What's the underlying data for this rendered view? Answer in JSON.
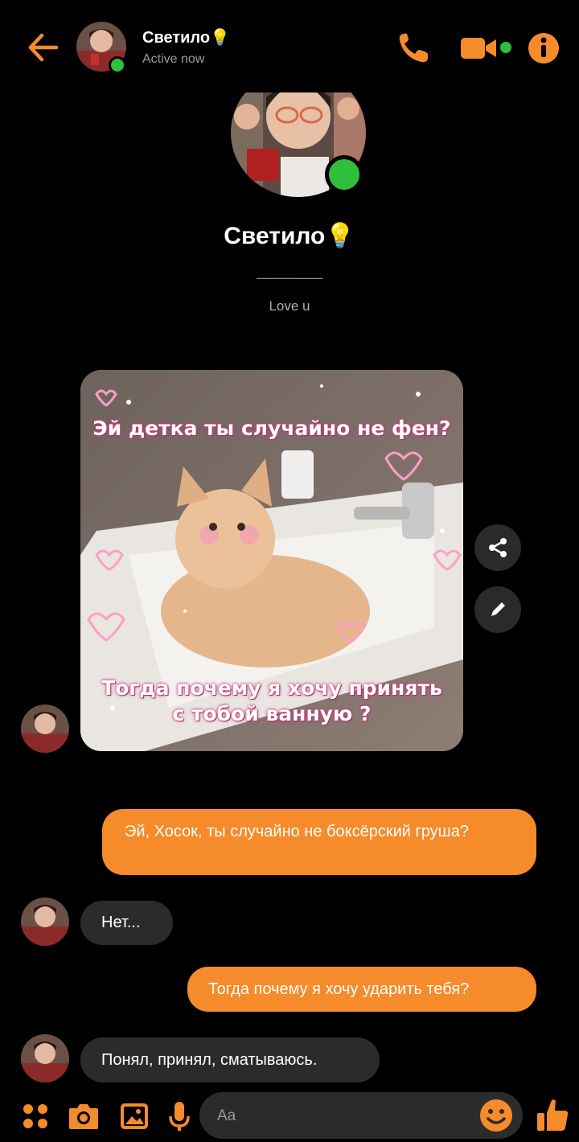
{
  "header": {
    "contact_name": "Светило💡",
    "status": "Active now"
  },
  "profile": {
    "name": "Светило💡",
    "divider": "________",
    "bio": "Love u"
  },
  "image_message": {
    "top_text": "Эй детка ты случайно не фен?",
    "bottom_text": "Тогда почему я хочу принять с тобой ванную ?"
  },
  "messages": [
    {
      "from": "me",
      "text": "Эй, Хосок, ты случайно не боксёрский груша?"
    },
    {
      "from": "them",
      "text": "Нет..."
    },
    {
      "from": "me",
      "text": "Тогда почему я хочу ударить тебя?"
    },
    {
      "from": "them",
      "text": "Понял, принял, сматываюсь."
    }
  ],
  "composer": {
    "placeholder": "Aa"
  },
  "colors": {
    "accent": "#f58b2a",
    "online": "#2fbf3c",
    "incoming_bubble": "#2b2b2b",
    "background": "#000000"
  },
  "icons": [
    "back-arrow-icon",
    "phone-icon",
    "video-camera-icon",
    "info-icon",
    "share-icon",
    "pencil-icon",
    "apps-grid-icon",
    "camera-icon",
    "gallery-icon",
    "microphone-icon",
    "emoji-icon",
    "thumbs-up-icon"
  ]
}
